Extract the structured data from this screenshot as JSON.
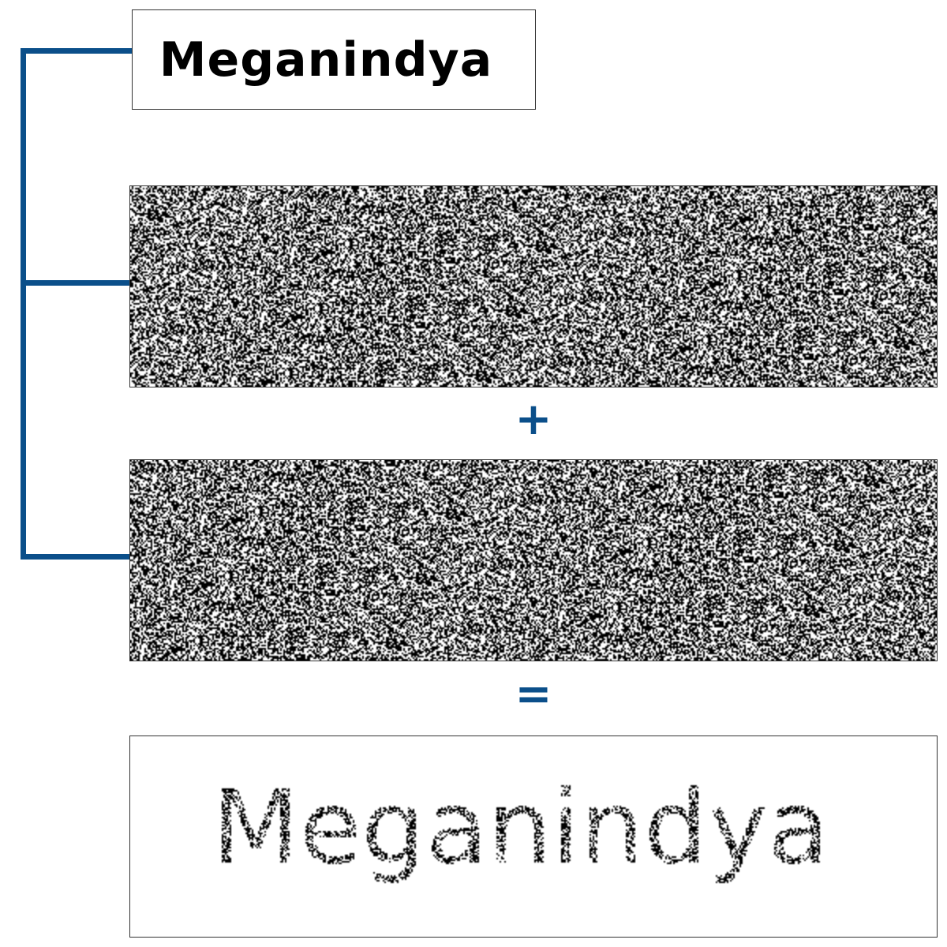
{
  "secret": {
    "text": "Meganindya"
  },
  "operators": {
    "plus": "+",
    "equals": "="
  },
  "colors": {
    "accent": "#0b4f8a",
    "pixel_dark": "#000000",
    "pixel_light": "#ffffff"
  }
}
